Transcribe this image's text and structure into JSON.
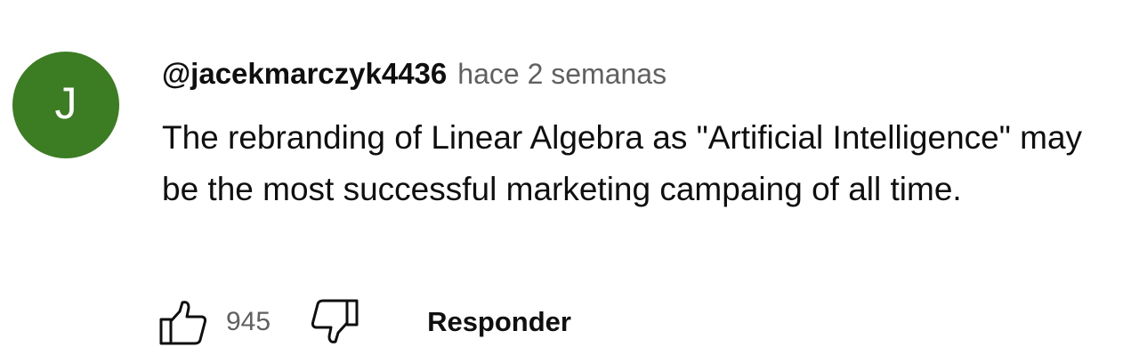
{
  "comment": {
    "avatar": {
      "letter": "J",
      "color": "#3c7c22"
    },
    "author": "@jacekmarczyk4436",
    "timestamp": "hace 2 semanas",
    "text": "The rebranding of Linear Algebra as \"Artificial Intelligence\" may be the most successful marketing campaing of all time.",
    "actions": {
      "like_icon": "thumbs-up-icon",
      "like_count": "945",
      "dislike_icon": "thumbs-down-icon",
      "reply_label": "Responder"
    }
  }
}
